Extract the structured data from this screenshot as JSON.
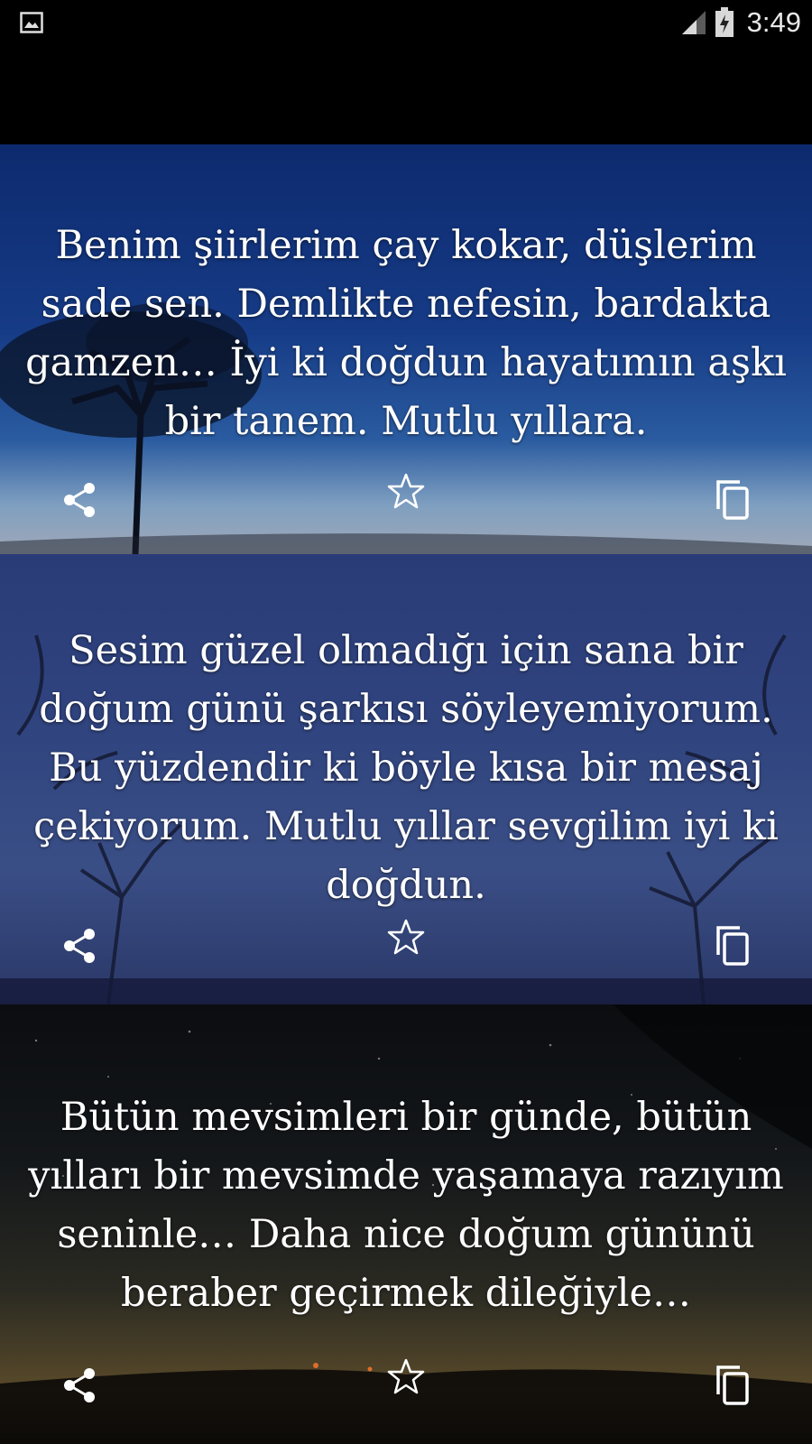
{
  "status_bar": {
    "notification_icon": "image-icon",
    "signal_icon": "signal-icon",
    "battery_icon": "battery-charging-icon",
    "time": "3:49"
  },
  "messages": [
    {
      "text": "Benim şiirlerim çay kokar, düşlerim sade sen. Demlikte nefesin, bardakta gamzen… İyi ki doğdun hayatımın aşkı bir tanem. Mutlu yıllara."
    },
    {
      "text": "Sesim güzel olmadığı için sana bir doğum günü şarkısı söyleyemiyorum. Bu yüzdendir ki böyle kısa bir mesaj çekiyorum. Mutlu yıllar sevgilim iyi ki doğdun."
    },
    {
      "text": "Bütün mevsimleri bir günde, bütün yılları bir mevsimde yaşamaya razıyım seninle… Daha nice doğum gününü beraber geçirmek dileğiyle…"
    }
  ],
  "actions": {
    "share_icon": "share-icon",
    "favorite_icon": "star-outline-icon",
    "copy_icon": "copy-icon"
  },
  "colors": {
    "icon": "#ffffff",
    "text": "#ffffff",
    "status_bar": "#000000"
  }
}
